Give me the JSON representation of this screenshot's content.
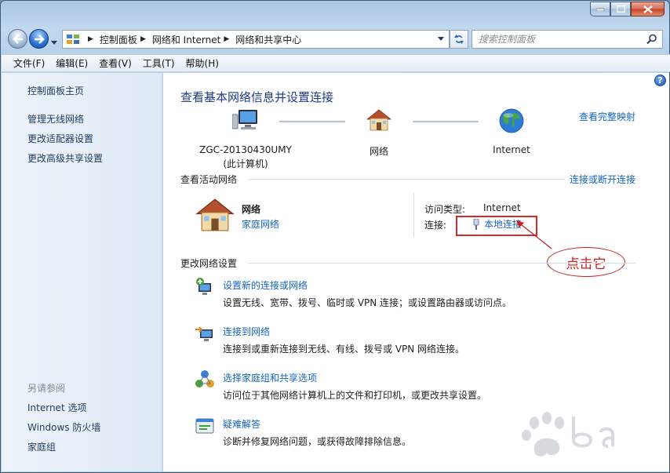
{
  "window": {
    "address_crumbs": [
      "控制面板",
      "网络和 Internet",
      "网络和共享中心"
    ],
    "search_placeholder": "搜索控制面板"
  },
  "menu": [
    "文件(F)",
    "编辑(E)",
    "查看(V)",
    "工具(T)",
    "帮助(H)"
  ],
  "sidebar": {
    "home": "控制面板主页",
    "links": [
      "管理无线网络",
      "更改适配器设置",
      "更改高级共享设置"
    ],
    "see_also_heading": "另请参阅",
    "see_also": [
      "Internet 选项",
      "Windows 防火墙",
      "家庭组"
    ]
  },
  "main": {
    "title": "查看基本网络信息并设置连接",
    "full_map_link": "查看完整映射",
    "nodes": {
      "computer_name": "ZGC-20130430UMY",
      "computer_sub": "(此计算机)",
      "network": "网络",
      "internet": "Internet"
    },
    "active": {
      "heading": "查看活动网络",
      "link": "连接或断开连接",
      "name": "网络",
      "type": "家庭网络",
      "access_label": "访问类型:",
      "access_value": "Internet",
      "conn_label": "连接:",
      "conn_value": "本地连接"
    },
    "change": {
      "heading": "更改网络设置",
      "tasks": [
        {
          "title": "设置新的连接或网络",
          "desc": "设置无线、宽带、拨号、临时或 VPN 连接；或设置路由器或访问点。",
          "icon": "new-connection-icon"
        },
        {
          "title": "连接到网络",
          "desc": "连接到或重新连接到无线、有线、拨号或 VPN 网络连接。",
          "icon": "connect-network-icon"
        },
        {
          "title": "选择家庭组和共享选项",
          "desc": "访问位于其他网络计算机上的文件和打印机，或更改共享设置。",
          "icon": "homegroup-icon"
        },
        {
          "title": "疑难解答",
          "desc": "诊断并修复网络问题，或获得故障排除信息。",
          "icon": "troubleshoot-icon"
        }
      ]
    },
    "annotation": "点击它"
  },
  "colors": {
    "link": "#1565c0",
    "title": "#1e3a8a",
    "annotation": "#c51f1f"
  }
}
